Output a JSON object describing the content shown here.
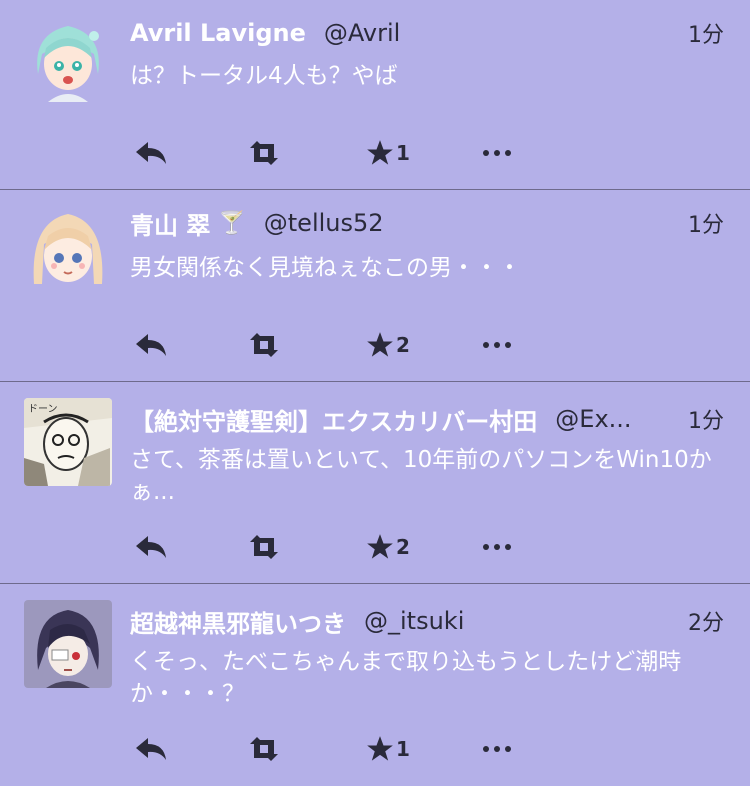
{
  "colors": {
    "background": "#b4b0e8",
    "text_light": "#ffffff",
    "text_dark": "#2a2a3a",
    "divider": "#6e6a8c"
  },
  "icons": {
    "reply": "reply-icon",
    "retweet": "retweet-icon",
    "favorite": "star-icon",
    "more": "more-icon"
  },
  "tweets": [
    {
      "name": "Avril Lavigne",
      "badge": "",
      "handle": "@Avril",
      "time": "1分",
      "text": "は？トータル4人も？やば",
      "favorites": "1"
    },
    {
      "name": "青山 翠",
      "badge": "🍸",
      "handle": "@tellus52",
      "time": "1分",
      "text": "男女関係なく見境ねぇなこの男・・・",
      "favorites": "2"
    },
    {
      "name": "【絶対守護聖剣】エクスカリバー村田",
      "badge": "",
      "handle": "@Ex...",
      "time": "1分",
      "text": "さて、茶番は置いといて、10年前のパソコンをWin10かぁ...",
      "favorites": "2"
    },
    {
      "name": "超越神黒邪龍いつき",
      "badge": "",
      "handle": "@_itsuki",
      "time": "2分",
      "text": "くそっ、たべこちゃんまで取り込もうとしたけど潮時か・・・？",
      "favorites": "1"
    }
  ]
}
